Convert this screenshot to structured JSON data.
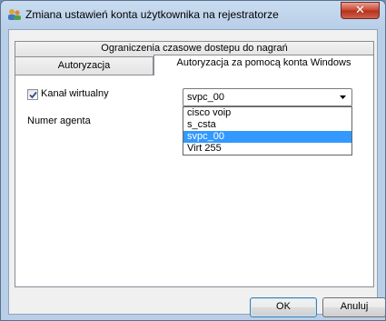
{
  "window": {
    "title": "Zmiana ustawień konta użytkownika na rejestratorze",
    "close_symbol": "✕"
  },
  "tabs": {
    "row1": "Ograniczenia czasowe dostepu do nagrań",
    "authorization": "Autoryzacja",
    "windows_auth": "Autoryzacja za pomocą konta Windows",
    "active": "windows_auth"
  },
  "form": {
    "virtual_channel_label": "Kanał wirtualny",
    "virtual_channel_checked": true,
    "agent_number_label": "Numer agenta",
    "combo_value": "svpc_00",
    "dropdown_options": [
      "cisco voip",
      "s_csta",
      "svpc_00",
      "Virt 255"
    ],
    "dropdown_selected_index": 2
  },
  "buttons": {
    "ok": "OK",
    "cancel": "Anuluj"
  },
  "icons": {
    "app": "users-icon",
    "close": "close-icon",
    "check": "checkmark-icon",
    "dropdown": "chevron-down-icon"
  }
}
